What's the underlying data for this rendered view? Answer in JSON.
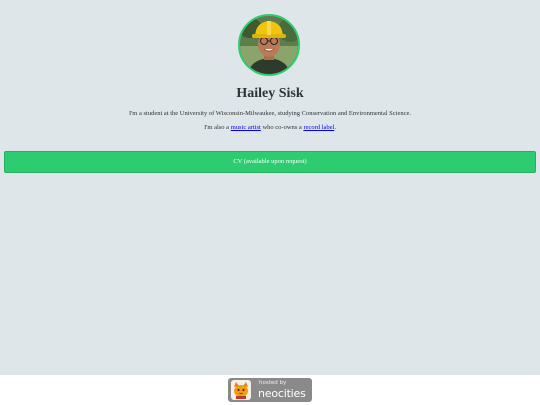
{
  "profile": {
    "name": "Hailey Sisk",
    "avatar_alt": "profile photo"
  },
  "bio": {
    "line1": "I'm a student at the University of Wisconsin-Milwaukee, studying Conservation and Environmental Science.",
    "line2_prefix": "I'm also a ",
    "music_artist_link": "music artist",
    "line2_middle": " who co-owns a ",
    "record_label_link": "record label",
    "line2_suffix": "."
  },
  "cv_button": {
    "label": "CV (available upon request)"
  },
  "footer": {
    "badge_small": "hosted by",
    "badge_big": "neocities"
  },
  "colors": {
    "background": "#dfe6e9",
    "accent": "#2ecc71",
    "text": "#2d3436",
    "link": "#0000ee"
  }
}
